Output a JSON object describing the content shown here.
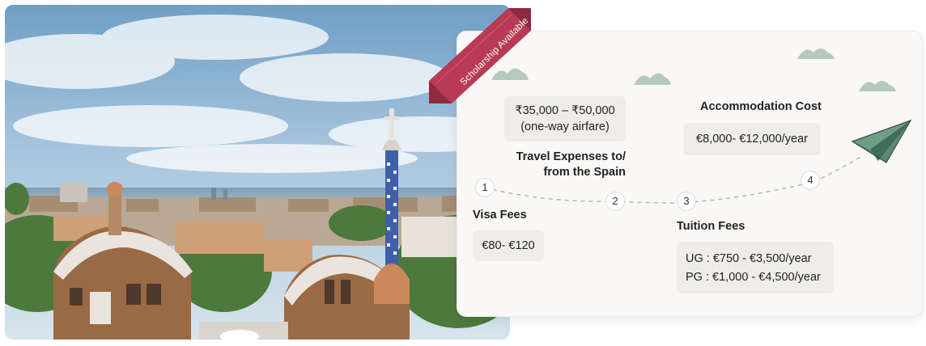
{
  "ribbon": {
    "label": "Scholarship Available",
    "color": "#b83a55"
  },
  "travel": {
    "cost_line1": "₹35,000 – ₹50,000",
    "cost_line2": "(one-way airfare)",
    "title_line1": "Travel Expenses to/",
    "title_line2": "from the Spain"
  },
  "accommodation": {
    "title": "Accommodation Cost",
    "cost": "€8,000- €12,000/year"
  },
  "visa": {
    "title": "Visa Fees",
    "cost": "€80- €120"
  },
  "tuition": {
    "title": "Tuition Fees",
    "ug": "UG : €750 - €3,500/year",
    "pg": "PG : €1,000 - €4,500/year"
  },
  "steps": [
    "1",
    "2",
    "3",
    "4"
  ],
  "colors": {
    "cloud": "#b5c9bc",
    "plane": "#4f7f68",
    "path": "#9fb9aa"
  },
  "icons": [
    "paper-plane-icon",
    "cloud-icon"
  ]
}
